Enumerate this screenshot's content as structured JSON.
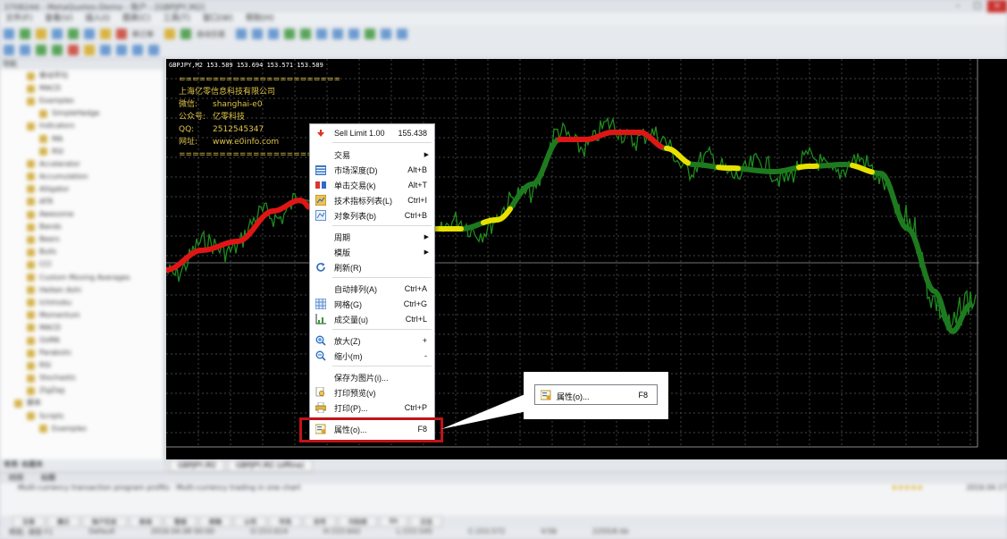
{
  "window": {
    "title": "3708244 - MetaQuotes-Demo - 账户 - [GBPJPY,M2]"
  },
  "menubar": [
    "文件(F)",
    "查看(V)",
    "插入(I)",
    "图表(C)",
    "工具(T)",
    "窗口(W)",
    "帮助(H)"
  ],
  "toolbar": {
    "new_order": "新订单",
    "auto_trading": "自动交易"
  },
  "navigator": {
    "header": "导航",
    "items": [
      "移动平均",
      "MACD",
      "Examples",
      "SimpleHedge",
      "Indicators",
      "MA",
      "RSI",
      "Accelerator",
      "Accumulation",
      "Alligator",
      "ATR",
      "Awesome",
      "Bands",
      "Bears",
      "Bulls",
      "CCI",
      "Custom Moving Averages",
      "Heiken Ashi",
      "Ichimoku",
      "Momentum",
      "MACD",
      "OsMA",
      "Parabolic",
      "RSI",
      "Stochastic",
      "ZigZag",
      "脚本",
      "Scripts",
      "Examples"
    ],
    "tabs": [
      "常用",
      "收藏夹"
    ]
  },
  "chart": {
    "header": "GBPJPY,M2  153.589 153.694 153.571 153.589",
    "info": {
      "divider": "========================",
      "company": "上海亿零信息科技有限公司",
      "rows": [
        {
          "key": "微信:",
          "value": "shanghai-e0"
        },
        {
          "key": "公众号:",
          "value": "亿零科技"
        },
        {
          "key": "QQ:",
          "value": "2512545347"
        },
        {
          "key": "网址:",
          "value": "www.e0info.com"
        }
      ]
    },
    "colors": {
      "green": "#1e8c1e",
      "red": "#e01515",
      "yellow": "#e8e000",
      "grid": "#6a6a6a"
    }
  },
  "context_menu": {
    "items": [
      {
        "label": "Sell Limit 1.00",
        "key": "155.438",
        "icon": "sell-limit-icon"
      },
      {
        "label": "交易",
        "submenu": true
      },
      {
        "label": "市场深度(D)",
        "key": "Alt+B",
        "icon": "market-depth-icon"
      },
      {
        "label": "单击交易(k)",
        "key": "Alt+T",
        "icon": "one-click-trading-icon"
      },
      {
        "label": "技术指标列表(L)",
        "key": "Ctrl+I",
        "icon": "indicators-list-icon"
      },
      {
        "label": "对象列表(b)",
        "key": "Ctrl+B",
        "icon": "objects-list-icon"
      },
      {
        "label": "周期",
        "submenu": true
      },
      {
        "label": "模版",
        "submenu": true
      },
      {
        "label": "刷新(R)",
        "icon": "refresh-icon"
      },
      {
        "label": "自动排列(A)",
        "key": "Ctrl+A"
      },
      {
        "label": "网格(G)",
        "key": "Ctrl+G",
        "icon": "grid-icon"
      },
      {
        "label": "成交量(u)",
        "key": "Ctrl+L",
        "icon": "volumes-icon"
      },
      {
        "label": "放大(Z)",
        "key": "+",
        "icon": "zoom-in-icon"
      },
      {
        "label": "缩小(m)",
        "key": "-",
        "icon": "zoom-out-icon"
      },
      {
        "label": "保存为图片(i)...",
        "icon": "save-picture-icon"
      },
      {
        "label": "打印预览(v)",
        "icon": "print-preview-icon"
      },
      {
        "label": "打印(P)...",
        "key": "Ctrl+P",
        "icon": "print-icon"
      },
      {
        "label": "属性(o)...",
        "key": "F8",
        "icon": "properties-icon"
      }
    ]
  },
  "callout": {
    "label": "属性(o)...",
    "key": "F8"
  },
  "chart_tabs": [
    "GBPJPY,M2",
    "GBPJPY,M2 (offline)"
  ],
  "terminal": {
    "headers": [
      "时间",
      "标题"
    ],
    "row": {
      "date": "2016.04.17",
      "text": "Multi-currency transaction program profits · Multi-currency trading in one chart",
      "stars": "★★★★★"
    },
    "tabs": [
      "交易",
      "展示",
      "账户历史",
      "新闻",
      "警报",
      "邮箱",
      "公司",
      "市场",
      "信号",
      "代码库",
      "EA",
      "日志"
    ]
  },
  "statusbar": [
    "帮助, 请按 F1",
    "Default",
    "2016.04.08 00:00",
    "O:153.614",
    "H:153.642",
    "L:153.545",
    "C:153.572",
    "V:56",
    "2255/6 kb"
  ]
}
